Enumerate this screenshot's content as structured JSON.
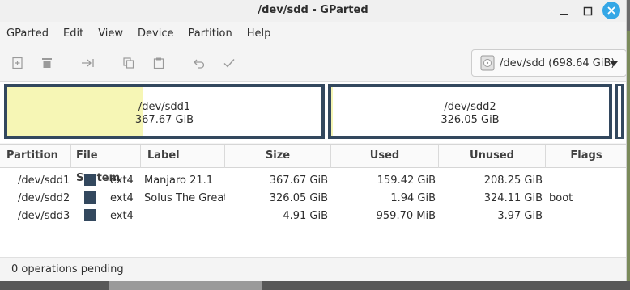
{
  "window": {
    "title": "/dev/sdd - GParted",
    "controls": {
      "minimize": "–",
      "maximize": "□",
      "close": "×"
    }
  },
  "menubar": {
    "items": [
      "GParted",
      "Edit",
      "View",
      "Device",
      "Partition",
      "Help"
    ]
  },
  "toolbar": {
    "icons": [
      "new-partition-icon",
      "delete-icon",
      "resize-move-icon",
      "copy-icon",
      "paste-icon",
      "undo-icon",
      "apply-icon"
    ],
    "device_select": {
      "label": "/dev/sdd (698.64 GiB)",
      "icon": "disk-icon"
    }
  },
  "diskmap": {
    "partitions": [
      {
        "name": "/dev/sdd1",
        "size": "367.67 GiB",
        "used_fraction": 0.4336
      },
      {
        "name": "/dev/sdd2",
        "size": "326.05 GiB",
        "used_fraction": 0.006
      },
      {
        "name": "/dev/sdd3",
        "size": "",
        "used_fraction": 0
      }
    ],
    "border_color": "#33485e",
    "used_color": "#f6f6b5"
  },
  "table": {
    "headers": [
      "Partition",
      "File System",
      "Label",
      "Size",
      "Used",
      "Unused",
      "Flags"
    ],
    "rows": [
      {
        "partition": "/dev/sdd1",
        "filesystem": "ext4",
        "label": "Manjaro 21.1",
        "size": "367.67 GiB",
        "used": "159.42 GiB",
        "unused": "208.25 GiB",
        "flags": ""
      },
      {
        "partition": "/dev/sdd2",
        "filesystem": "ext4",
        "label": "Solus The Great",
        "size": "326.05 GiB",
        "used": "1.94 GiB",
        "unused": "324.11 GiB",
        "flags": "boot"
      },
      {
        "partition": "/dev/sdd3",
        "filesystem": "ext4",
        "label": "",
        "size": "4.91 GiB",
        "used": "959.70 MiB",
        "unused": "3.97 GiB",
        "flags": ""
      }
    ],
    "fs_color": "#33485e"
  },
  "status": {
    "text": "0 operations pending"
  }
}
